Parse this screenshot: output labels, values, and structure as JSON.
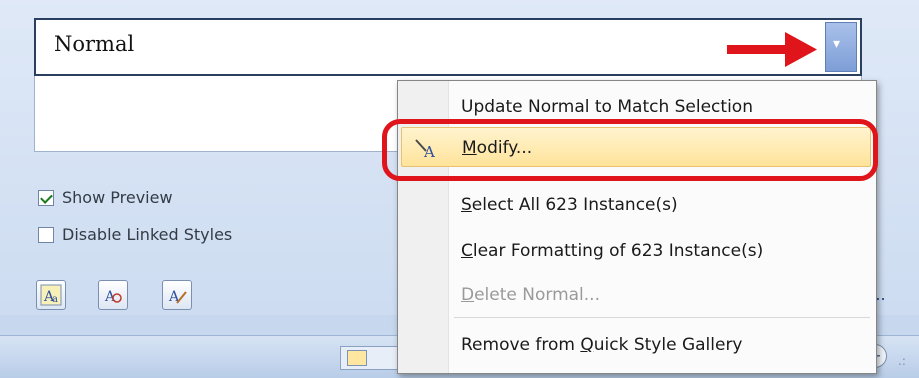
{
  "style_box": {
    "style_name": "Normal"
  },
  "options": {
    "show_preview": {
      "label": "Show Preview",
      "checked": true
    },
    "disable_linked": {
      "label": "Disable Linked Styles",
      "checked": false
    }
  },
  "style_buttons": [
    {
      "icon": "new-style-icon"
    },
    {
      "icon": "style-inspector-icon"
    },
    {
      "icon": "manage-styles-icon"
    }
  ],
  "options_link": "s...",
  "context_menu": {
    "update": {
      "pre": "Update Normal to Match Selection",
      "key": "",
      "post": ""
    },
    "modify": {
      "pre": "",
      "key": "M",
      "post": "odify..."
    },
    "select_all": {
      "pre": "",
      "key": "S",
      "post": "elect All 623 Instance(s)"
    },
    "clear_formatting": {
      "pre": "",
      "key": "C",
      "post": "lear Formatting of 623 Instance(s)"
    },
    "delete": {
      "pre": "",
      "key": "D",
      "post": "elete Normal..."
    },
    "remove_gallery": {
      "pre": "Remove from ",
      "key": "Q",
      "post": "uick Style Gallery"
    }
  },
  "status_bar": {
    "zoom_in_glyph": "+",
    "resize_glyph": ".:"
  },
  "colors": {
    "highlight_bg": "#ffe39a",
    "annotation_red": "#e0141b",
    "pane_bg": "#dfe9f7"
  }
}
